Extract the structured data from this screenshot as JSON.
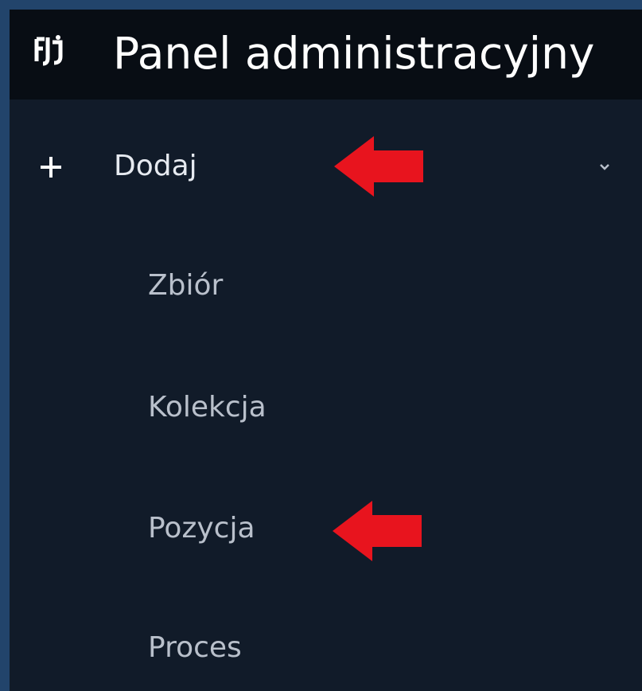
{
  "header": {
    "title": "Panel administracyjny",
    "logo_icon": "app-logo-icon"
  },
  "menu": {
    "parent": {
      "label": "Dodaj",
      "icon": "plus-icon",
      "expanded": true,
      "toggle_icon": "chevron-down-icon"
    },
    "items": [
      {
        "label": "Zbiór"
      },
      {
        "label": "Kolekcja"
      },
      {
        "label": "Pozycja"
      },
      {
        "label": "Proces"
      }
    ]
  },
  "annotations": {
    "arrow_color": "#e8141e",
    "arrow_icon": "arrow-left-icon"
  },
  "colors": {
    "outer_border": "#22446b",
    "header_bg": "#080d14",
    "sidebar_bg": "#111b29",
    "title_text": "#ffffff",
    "sub_item_text": "#b9c0cb"
  }
}
